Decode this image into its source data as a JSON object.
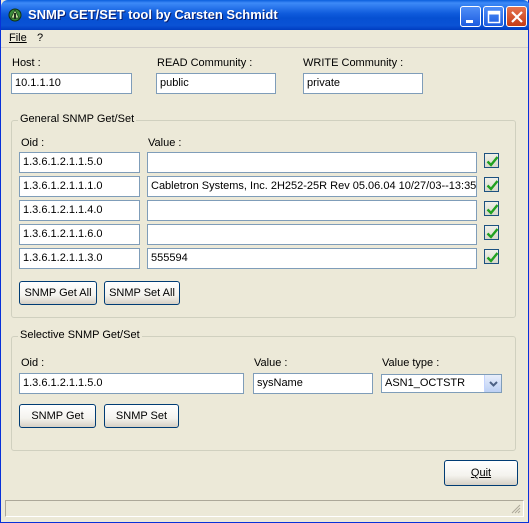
{
  "window": {
    "title": "SNMP GET/SET tool by Carsten Schmidt"
  },
  "menu": {
    "file": "File",
    "help": "?"
  },
  "host": {
    "label": "Host :",
    "value": "10.1.1.10"
  },
  "read_community": {
    "label": "READ Community :",
    "value": "public"
  },
  "write_community": {
    "label": "WRITE Community :",
    "value": "private"
  },
  "general": {
    "title": "General SNMP Get/Set",
    "oid_header": "Oid :",
    "value_header": "Value :",
    "rows": [
      {
        "oid": "1.3.6.1.2.1.1.5.0",
        "value": "",
        "checked": true
      },
      {
        "oid": "1.3.6.1.2.1.1.1.0",
        "value": "Cabletron Systems, Inc. 2H252-25R Rev 05.06.04  10/27/03--13:35",
        "checked": true
      },
      {
        "oid": "1.3.6.1.2.1.1.4.0",
        "value": "",
        "checked": true
      },
      {
        "oid": "1.3.6.1.2.1.1.6.0",
        "value": "",
        "checked": true
      },
      {
        "oid": "1.3.6.1.2.1.1.3.0",
        "value": "555594",
        "checked": true
      }
    ],
    "get_all_label": "SNMP Get All",
    "set_all_label": "SNMP Set All"
  },
  "selective": {
    "title": "Selective SNMP Get/Set",
    "oid_label": "Oid :",
    "oid_value": "1.3.6.1.2.1.1.5.0",
    "value_label": "Value :",
    "value_value": "sysName",
    "type_label": "Value type :",
    "type_value": "ASN1_OCTSTR",
    "get_label": "SNMP Get",
    "set_label": "SNMP Set"
  },
  "quit_label": "Quit",
  "colors": {
    "titlebar": "#0a52d5",
    "window_bg": "#ece9d8",
    "check_green": "#21a121"
  }
}
